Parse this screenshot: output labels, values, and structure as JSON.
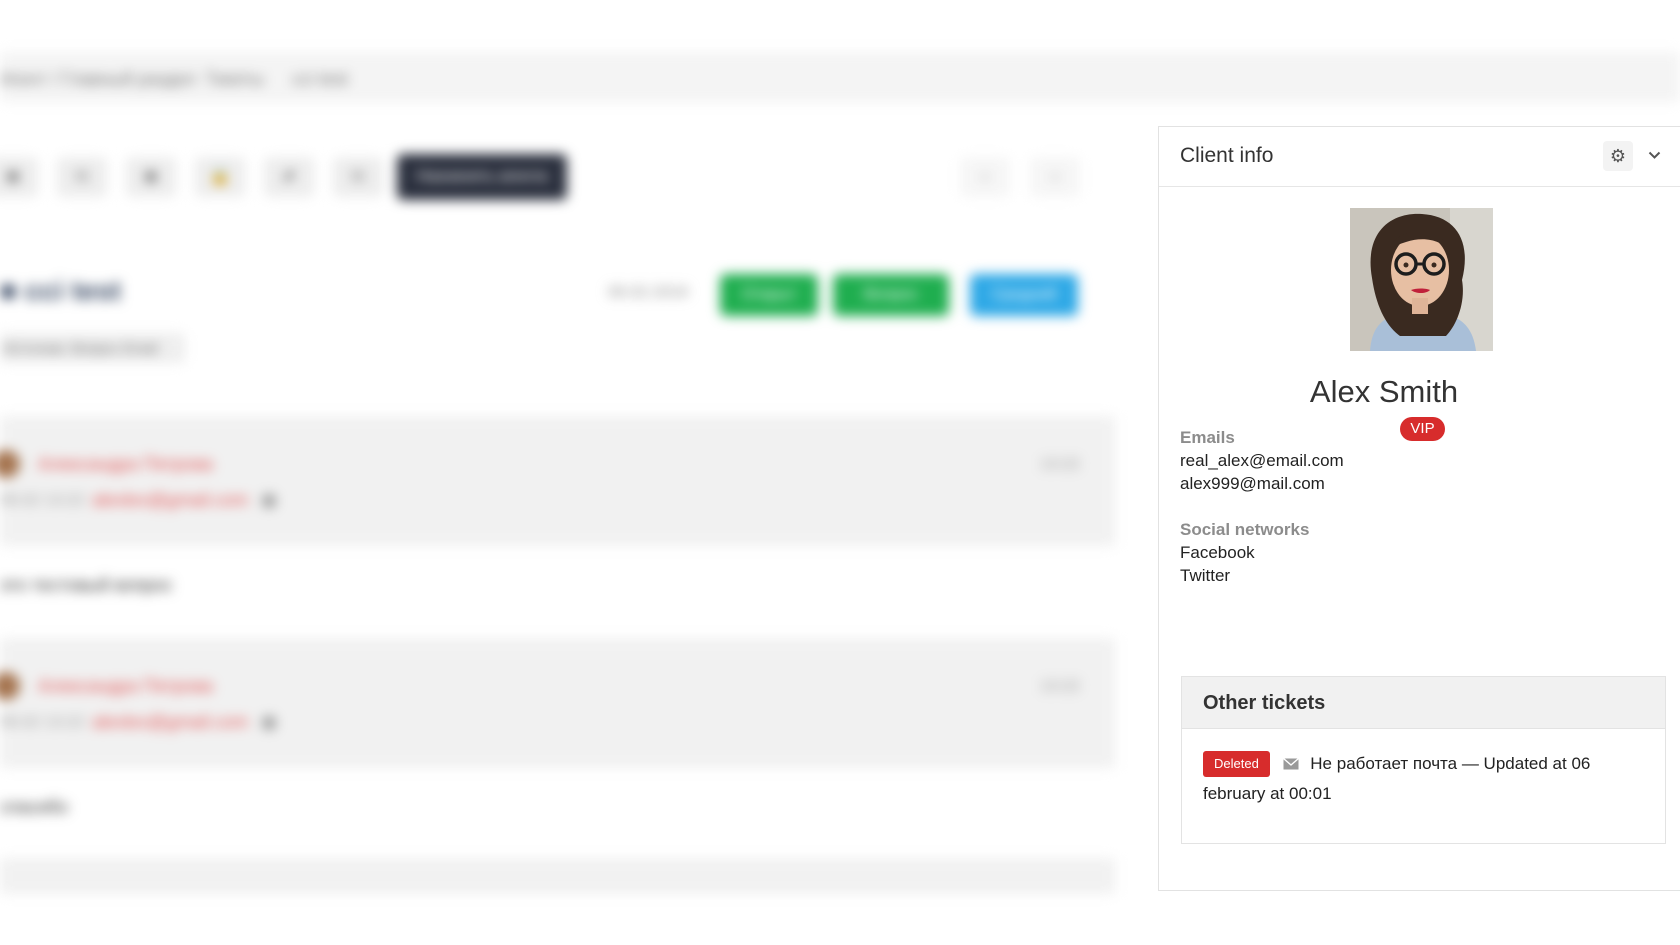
{
  "background": {
    "breadcrumb": [
      "Агент / Главный раздел",
      "Тикеты",
      "ссі test"
    ],
    "toolbar_icons": [
      "◉",
      "⧉",
      "◉",
      "🔒",
      "⬈",
      "⧉"
    ],
    "toolbar_action_label": "Назначить агента",
    "nav_icons": [
      "‹",
      "›"
    ],
    "ticket_title": "■ ссі test",
    "ticket_subtitle": "Источник: Вопрос Email",
    "ticket_date": "06.02.2019",
    "tags": [
      "Открыт",
      "Вопрос",
      "Средний"
    ],
    "messages": [
      {
        "author": "Александра Петрова",
        "prefix": "06.02 13:22",
        "email": "alexlex@gmail.com",
        "time": "13:22",
        "body": "это тестовый вопрос"
      },
      {
        "author": "Александра Петрова",
        "prefix": "06.02 13:22",
        "email": "alexlex@gmail.com",
        "time": "13:22",
        "body": "спасибо"
      }
    ]
  },
  "client_panel": {
    "title": "Client info",
    "gear_icon": "gear-icon",
    "chevron_icon": "chevron-down-icon",
    "client_name": "Alex Smith",
    "vip_label": "VIP",
    "emails_label": "Emails",
    "emails": [
      "real_alex@email.com",
      "alex999@mail.com"
    ],
    "social_label": "Social networks",
    "social": [
      "Facebook",
      "Twitter"
    ],
    "other_tickets": {
      "title": "Other tickets",
      "items": [
        {
          "status": "Deleted",
          "icon": "envelope-icon",
          "text": "Не работает почта — Updated at 06 february at 00:01"
        }
      ]
    }
  },
  "colors": {
    "vip": "#d72c2c",
    "deleted": "#d72c2c",
    "accent_green": "#1fae4f",
    "accent_blue": "#2da8e6",
    "dark_button": "#2a2f3d"
  }
}
